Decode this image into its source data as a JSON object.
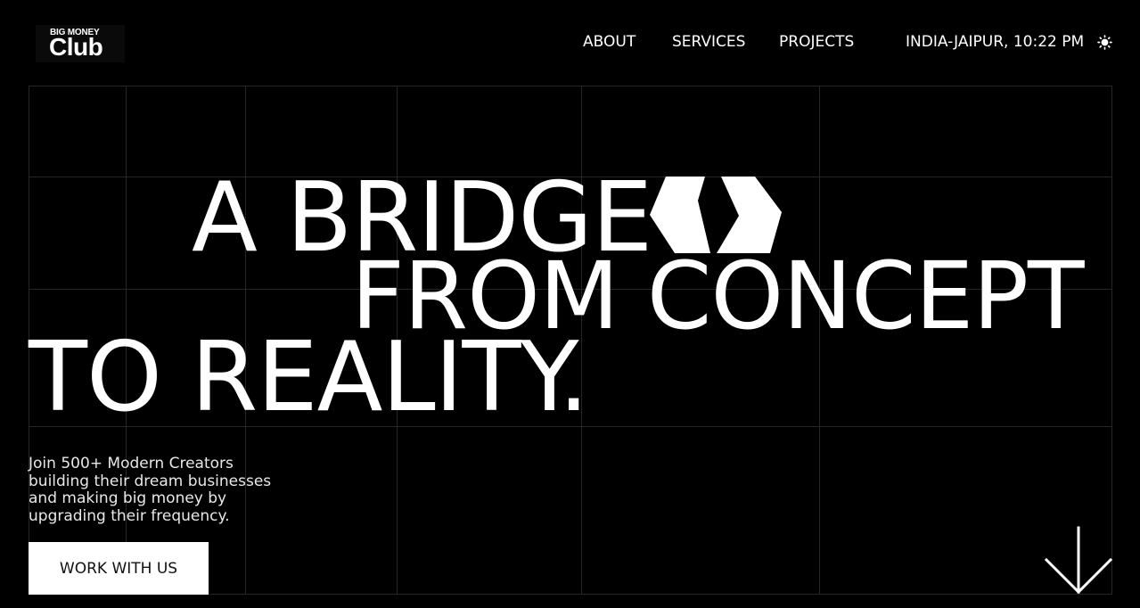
{
  "header": {
    "logo": {
      "top": "BIG MONEY",
      "main": "Club"
    },
    "nav": [
      {
        "label": "ABOUT"
      },
      {
        "label": "SERVICES"
      },
      {
        "label": "PROJECTS"
      }
    ],
    "location": "INDIA-JAIPUR, 10:22 PM",
    "theme_icon": "sun-icon"
  },
  "hero": {
    "headline_line1": "A BRIDGE",
    "headline_line2": "FROM CONCEPT",
    "headline_line3": "TO REALITY.",
    "brand_mark_icon": "split-pentagon-icon",
    "subtext": "Join 500+ Modern Creators building their dream businesses and making big money by upgrading their frequency.",
    "cta_label": "WORK WITH US",
    "scroll_icon": "arrow-down-icon"
  },
  "colors": {
    "background": "#000000",
    "text": "#ffffff",
    "grid": "#262626",
    "button_bg": "#ffffff",
    "button_text": "#111111"
  }
}
